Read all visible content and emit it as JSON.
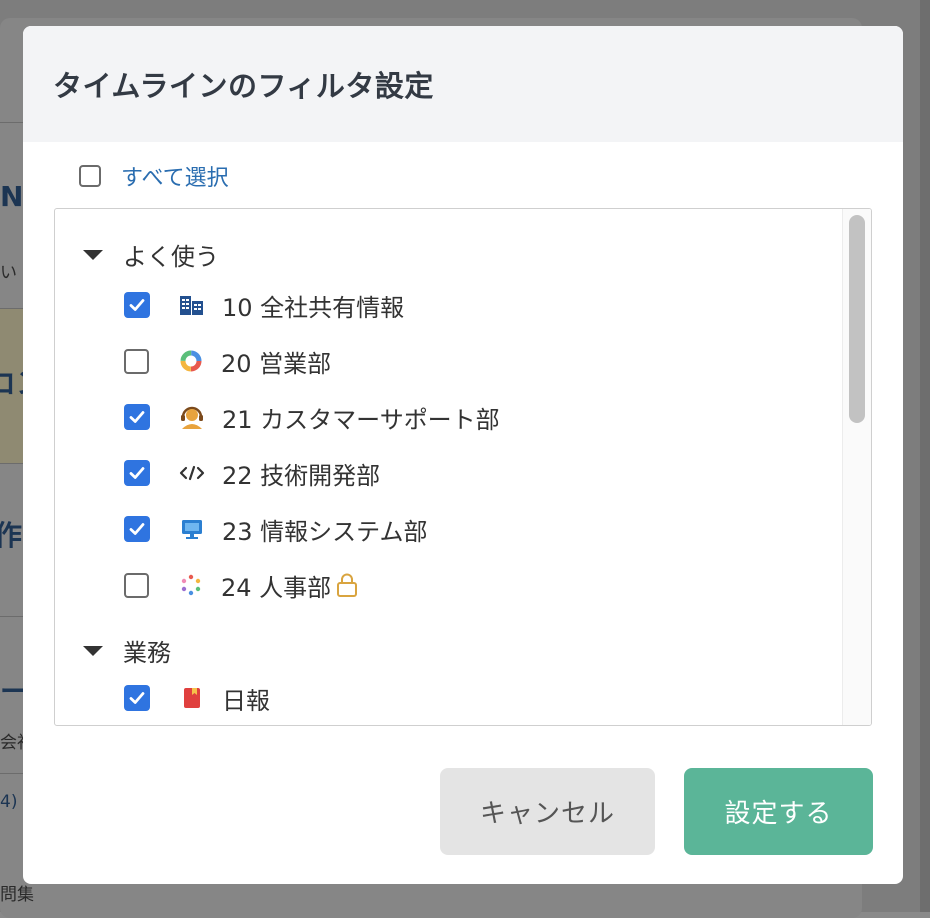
{
  "background": {
    "texts": [
      "N",
      "い",
      "コン",
      "作",
      "ー",
      "会社",
      "4)",
      "問集"
    ]
  },
  "modal": {
    "title": "タイムラインのフィルタ設定",
    "select_all_label": "すべて選択",
    "groups": [
      {
        "label": "よく使う",
        "items": [
          {
            "label": "10 全社共有情報",
            "checked": true,
            "icon": "building-icon"
          },
          {
            "label": "20 営業部",
            "checked": false,
            "icon": "ring-icon"
          },
          {
            "label": "21 カスタマーサポート部",
            "checked": true,
            "icon": "headset-icon"
          },
          {
            "label": "22 技術開発部",
            "checked": true,
            "icon": "code-icon"
          },
          {
            "label": "23 情報システム部",
            "checked": true,
            "icon": "monitor-icon"
          },
          {
            "label": "24 人事部",
            "checked": false,
            "icon": "dots-icon",
            "locked": true
          }
        ]
      },
      {
        "label": "業務",
        "items": [
          {
            "label": "日報",
            "checked": true,
            "icon": "bookmark-icon"
          }
        ]
      }
    ],
    "buttons": {
      "cancel": "キャンセル",
      "submit": "設定する"
    }
  },
  "colors": {
    "checkbox_checked": "#2f74e0",
    "link": "#2a6db0",
    "primary_button": "#5bb598",
    "secondary_button": "#e4e4e4"
  }
}
